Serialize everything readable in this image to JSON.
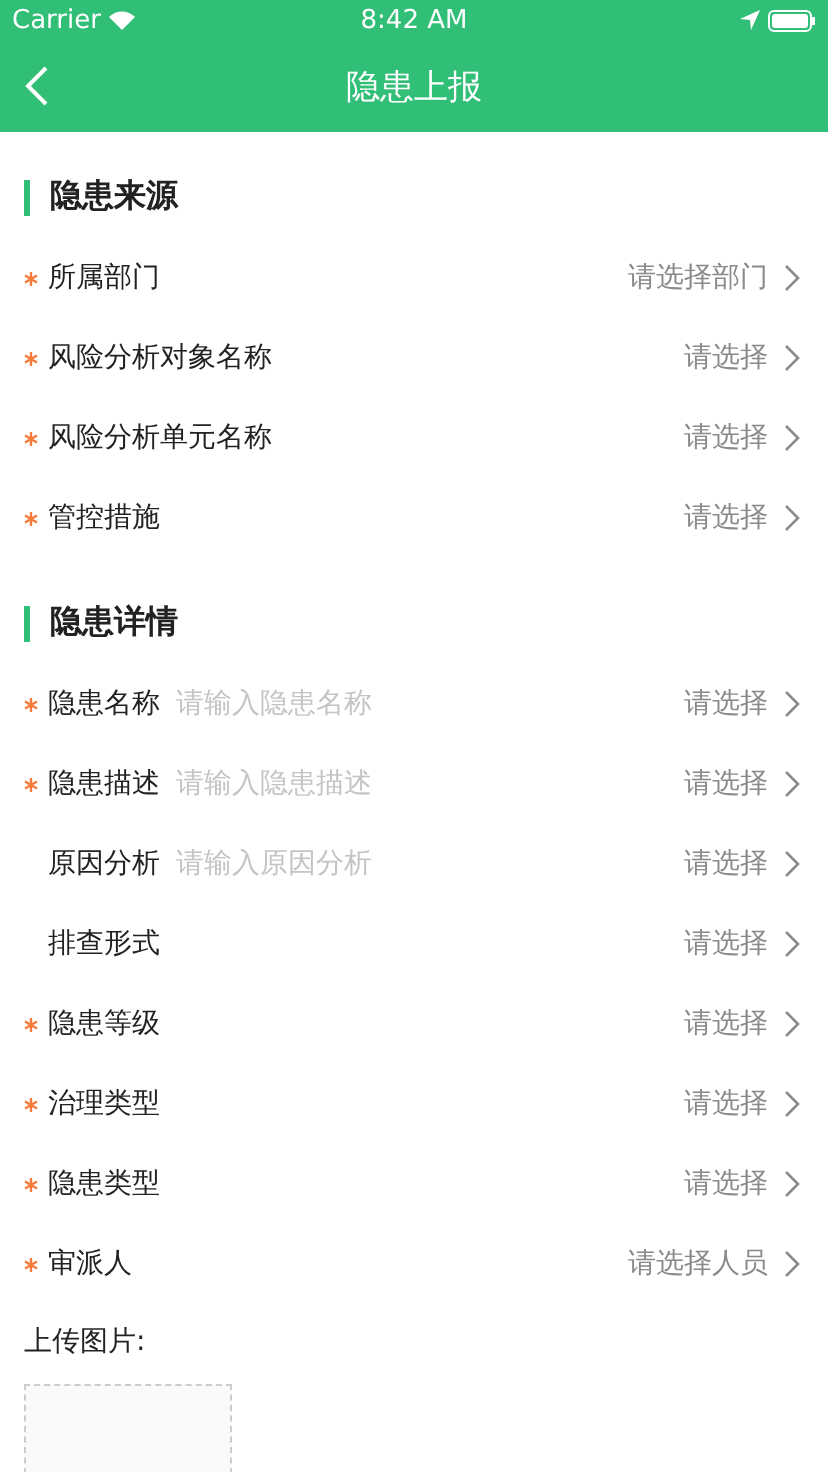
{
  "status_bar": {
    "carrier": "Carrier",
    "time": "8:42 AM"
  },
  "nav": {
    "title": "隐患上报"
  },
  "sections": [
    {
      "title": "隐患来源",
      "rows": [
        {
          "label": "所属部门",
          "required": true,
          "value": "请选择部门"
        },
        {
          "label": "风险分析对象名称",
          "required": true,
          "value": "请选择"
        },
        {
          "label": "风险分析单元名称",
          "required": true,
          "value": "请选择"
        },
        {
          "label": "管控措施",
          "required": true,
          "value": "请选择"
        }
      ]
    },
    {
      "title": "隐患详情",
      "rows": [
        {
          "label": "隐患名称",
          "required": true,
          "placeholder": "请输入隐患名称",
          "value": "请选择"
        },
        {
          "label": "隐患描述",
          "required": true,
          "placeholder": "请输入隐患描述",
          "value": "请选择"
        },
        {
          "label": "原因分析",
          "required": false,
          "placeholder": "请输入原因分析",
          "value": "请选择"
        },
        {
          "label": "排查形式",
          "required": false,
          "value": "请选择"
        },
        {
          "label": "隐患等级",
          "required": true,
          "value": "请选择"
        },
        {
          "label": "治理类型",
          "required": true,
          "value": "请选择"
        },
        {
          "label": "隐患类型",
          "required": true,
          "value": "请选择"
        },
        {
          "label": "审派人",
          "required": true,
          "value": "请选择人员"
        }
      ]
    }
  ],
  "upload": {
    "label": "上传图片:"
  }
}
